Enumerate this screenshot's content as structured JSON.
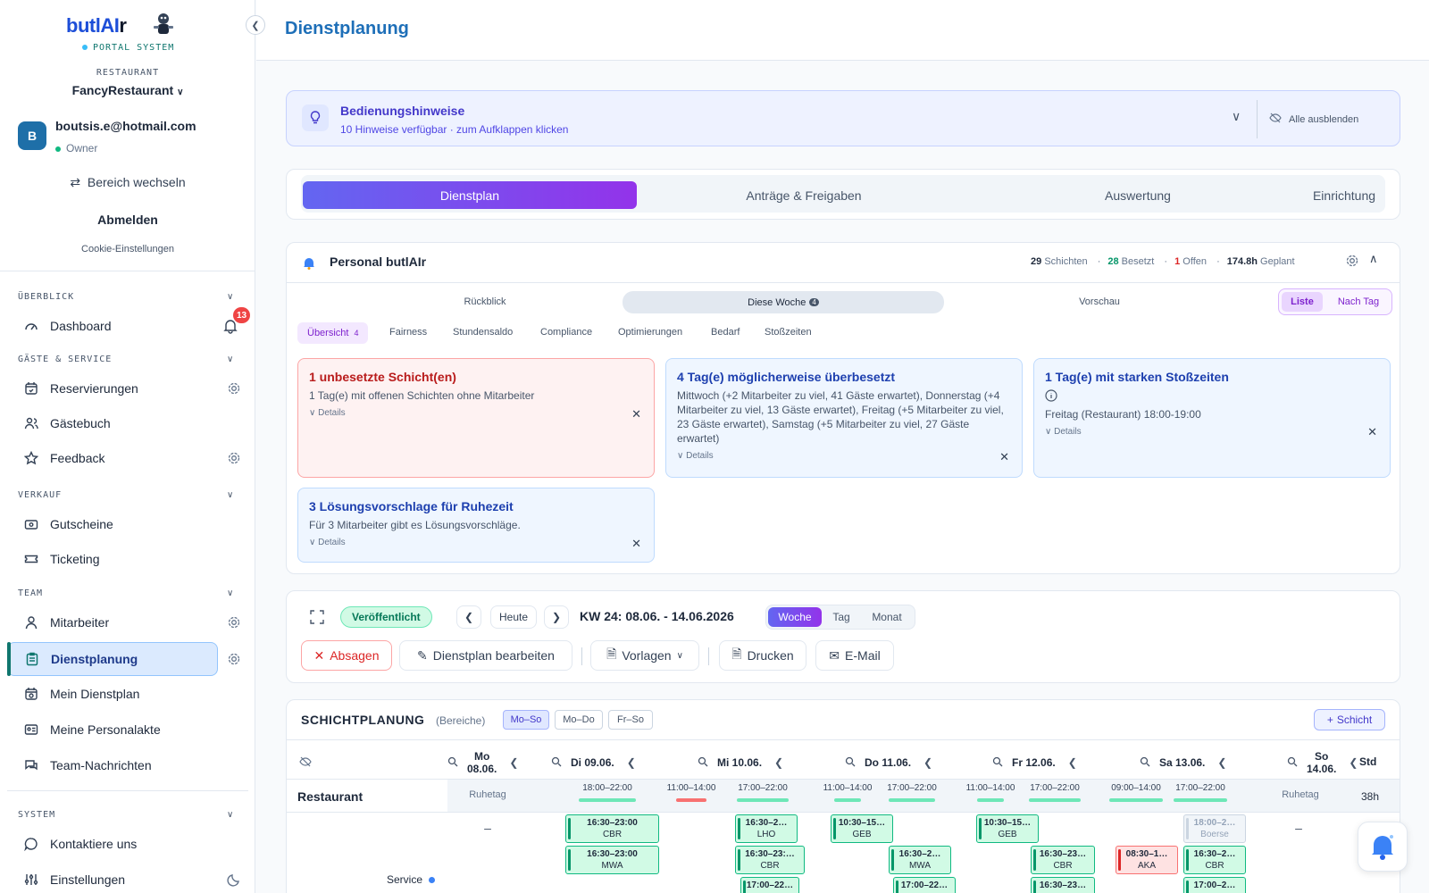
{
  "sidebar": {
    "brand_a": "butlAI",
    "brand_b": "r",
    "portal": "PORTAL SYSTEM",
    "restaurant_label": "RESTAURANT",
    "restaurant_name": "FancyRestaurant",
    "avatar_initial": "B",
    "user_email": "boutsis.e@hotmail.com",
    "user_role": "Owner",
    "switch_area": "Bereich wechseln",
    "logout": "Abmelden",
    "cookie": "Cookie-Einstellungen",
    "notification_count": "13",
    "sections": {
      "overview": "ÜBERBLICK",
      "guests": "GÄSTE & SERVICE",
      "sales": "VERKAUF",
      "team": "TEAM",
      "system": "SYSTEM"
    },
    "items": {
      "dashboard": "Dashboard",
      "reservations": "Reservierungen",
      "guestbook": "Gästebuch",
      "feedback": "Feedback",
      "vouchers": "Gutscheine",
      "ticketing": "Ticketing",
      "employees": "Mitarbeiter",
      "duty_planning": "Dienstplanung",
      "my_plan": "Mein Dienstplan",
      "my_file": "Meine Personalakte",
      "team_messages": "Team-Nachrichten",
      "contact": "Kontaktiere uns",
      "settings": "Einstellungen"
    }
  },
  "header": {
    "title": "Dienstplanung"
  },
  "hints": {
    "title": "Bedienungshinweise",
    "subtitle": "10 Hinweise verfügbar · zum Aufklappen klicken",
    "hide_all": "Alle ausblenden"
  },
  "tabs": [
    "Dienstplan",
    "Anträge & Freigaben",
    "Auswertung",
    "Einrichtung"
  ],
  "personal": {
    "title": "Personal butlAIr",
    "shifts_n": "29",
    "shifts_l": "Schichten",
    "filled_n": "28",
    "filled_l": "Besetzt",
    "open_n": "1",
    "open_l": "Offen",
    "hours_n": "174.8h",
    "hours_l": "Geplant",
    "periods": [
      "Rückblick",
      "Diese Woche",
      "Vorschau"
    ],
    "this_week_badge": "4",
    "view_list": "Liste",
    "view_day": "Nach Tag",
    "subtabs": [
      "Übersicht",
      "Fairness",
      "Stundensaldo",
      "Compliance",
      "Optimierungen",
      "Bedarf",
      "Stoßzeiten"
    ],
    "overview_badge": "4",
    "details": "Details",
    "alerts": [
      {
        "title": "1 unbesetzte Schicht(en)",
        "desc": "1 Tag(e) mit offenen Schichten ohne Mitarbeiter"
      },
      {
        "title": "4 Tag(e) möglicherweise überbesetzt",
        "desc": "Mittwoch (+2 Mitarbeiter zu viel, 41 Gäste erwartet), Donnerstag (+4 Mitarbeiter zu viel, 13 Gäste erwartet), Freitag (+5 Mitarbeiter zu viel, 23 Gäste erwartet), Samstag (+5 Mitarbeiter zu viel, 27 Gäste erwartet)"
      },
      {
        "title": "1 Tag(e) mit starken Stoßzeiten",
        "desc": "Freitag (Restaurant) 18:00-19:00"
      },
      {
        "title": "3 Lösungsvorschlage für Ruhezeit",
        "desc": "Für 3 Mitarbeiter gibt es Lösungsvorschläge."
      }
    ]
  },
  "controls": {
    "status": "Veröffentlicht",
    "today": "Heute",
    "week_label": "KW 24: 08.06. - 14.06.2026",
    "views": [
      "Woche",
      "Tag",
      "Monat"
    ],
    "cancel": "Absagen",
    "edit": "Dienstplan bearbeiten",
    "templates": "Vorlagen",
    "print": "Drucken",
    "email": "E-Mail"
  },
  "schedule": {
    "title": "SCHICHTPLANUNG",
    "sub": "(Bereiche)",
    "filters": [
      "Mo–So",
      "Mo–Do",
      "Fr–So"
    ],
    "add": "Schicht",
    "std": "Std",
    "area": "Restaurant",
    "area_hours": "38h",
    "role": "Service",
    "days": [
      {
        "l1": "Mo",
        "l2": "08.06."
      },
      {
        "l1": "Di 09.06.",
        "l2": ""
      },
      {
        "l1": "Mi 10.06.",
        "l2": ""
      },
      {
        "l1": "Do 11.06.",
        "l2": ""
      },
      {
        "l1": "Fr 12.06.",
        "l2": ""
      },
      {
        "l1": "Sa 13.06.",
        "l2": ""
      },
      {
        "l1": "So",
        "l2": "14.06."
      }
    ],
    "ruhetag": "Ruhetag",
    "dash": "–",
    "times": [
      "18:00–22:00",
      "11:00–14:00",
      "17:00–22:00",
      "11:00–14:00",
      "17:00–22:00",
      "11:00–14:00",
      "17:00–22:00",
      "09:00–14:00",
      "17:00–22:00"
    ],
    "shifts": [
      {
        "t": "16:30–23:00",
        "n": "CBR"
      },
      {
        "t": "16:30–23:00",
        "n": "MWA"
      },
      {
        "t": "16:30–2…",
        "n": "LHO"
      },
      {
        "t": "16:30–23:…",
        "n": "CBR"
      },
      {
        "t": "17:00–22…",
        "n": ""
      },
      {
        "t": "10:30–15…",
        "n": "GEB"
      },
      {
        "t": "16:30–2…",
        "n": "MWA"
      },
      {
        "t": "17:00–22…",
        "n": ""
      },
      {
        "t": "10:30–15…",
        "n": "GEB"
      },
      {
        "t": "16:30–23…",
        "n": "CBR"
      },
      {
        "t": "16:30–23…",
        "n": "CBR"
      },
      {
        "t": "08:30–1…",
        "n": "AKA"
      },
      {
        "t": "18:00–2…",
        "n": "Boerse"
      },
      {
        "t": "16:30–2…",
        "n": "CBR"
      },
      {
        "t": "17:00–2…",
        "n": ""
      }
    ]
  }
}
